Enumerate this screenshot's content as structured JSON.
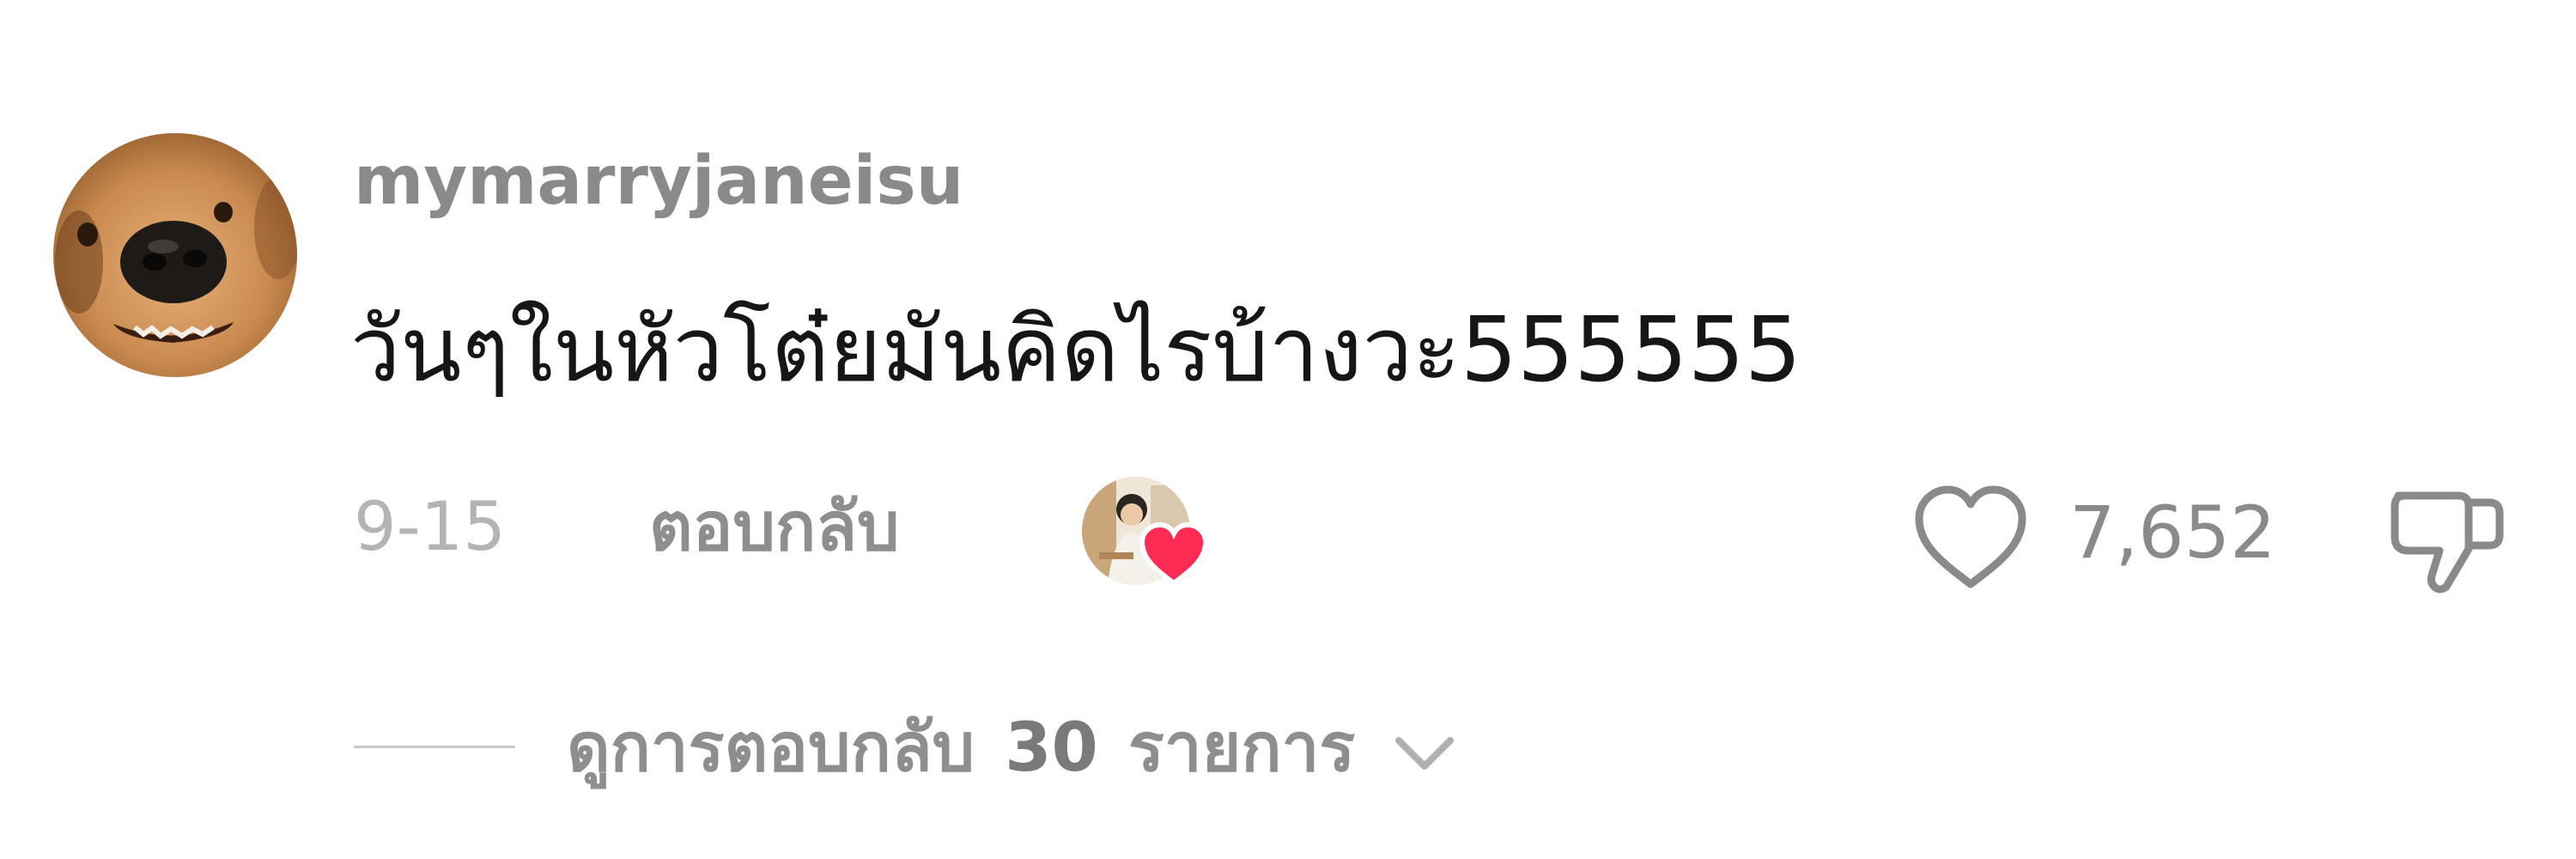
{
  "comment": {
    "username": "mymarryjaneisu",
    "text": "วันๆในหัวโต๋ยมันคิดไรบ้างวะ555555",
    "date": "9-15",
    "reply_label": "ตอบกลับ",
    "like_count": "7,652",
    "liked_by_creator": true
  },
  "replies": {
    "prefix": "ดูการตอบกลับ",
    "count": "30",
    "suffix": "รายการ"
  },
  "icons": {
    "avatar": "dog-avatar",
    "creator_like": "creator-heart-icon",
    "like": "heart-outline-icon",
    "dislike": "thumbs-down-icon",
    "expand": "chevron-down-icon"
  },
  "colors": {
    "heart_red": "#fe2c55",
    "text_primary": "#161616",
    "text_secondary": "#8a8a8a",
    "date": "#b4b4b4"
  }
}
